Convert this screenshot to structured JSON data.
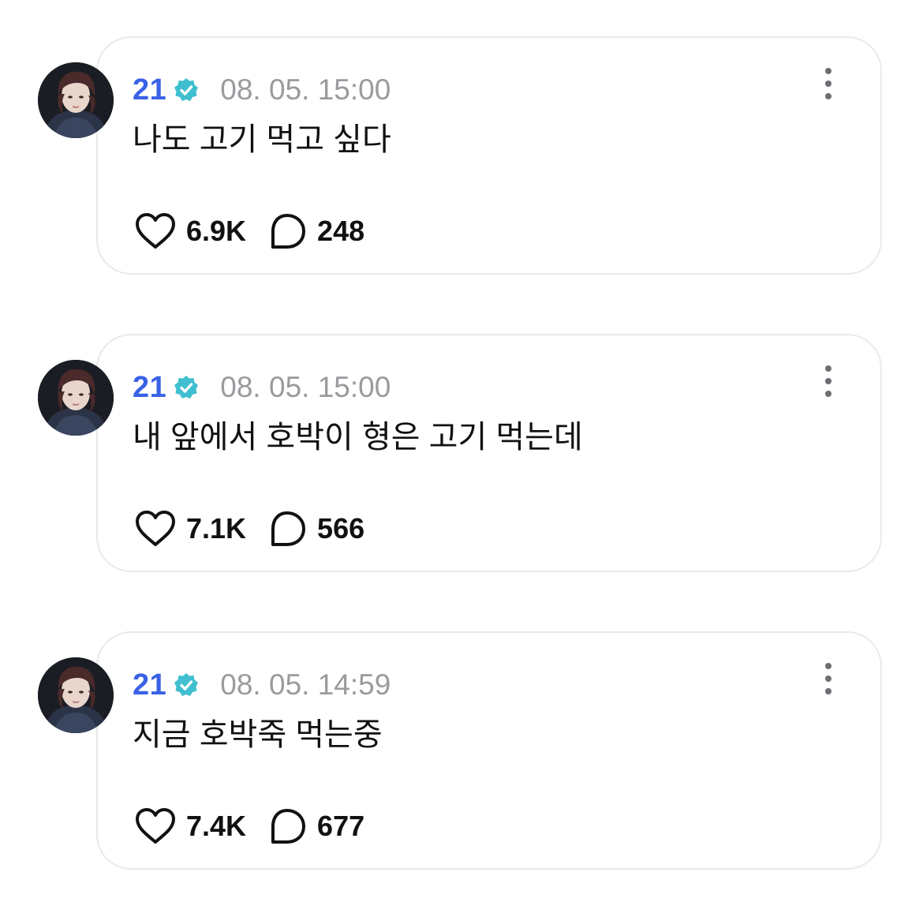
{
  "posts": [
    {
      "author": "21",
      "verified_icon": "verified-check-icon",
      "timestamp": "08. 05. 15:00",
      "text": "나도 고기 먹고 싶다",
      "likes": "6.9K",
      "replies": "248"
    },
    {
      "author": "21",
      "verified_icon": "verified-check-icon",
      "timestamp": "08. 05. 15:00",
      "text": "내 앞에서 호박이 형은 고기 먹는데",
      "likes": "7.1K",
      "replies": "566"
    },
    {
      "author": "21",
      "verified_icon": "verified-check-icon",
      "timestamp": "08. 05. 14:59",
      "text": "지금 호박죽 먹는중",
      "likes": "7.4K",
      "replies": "677"
    }
  ],
  "colors": {
    "author": "#3a62e6",
    "verified_badge": "#3fbfcf",
    "timestamp": "#9a9a9f",
    "card_border": "#e9e9ee"
  }
}
